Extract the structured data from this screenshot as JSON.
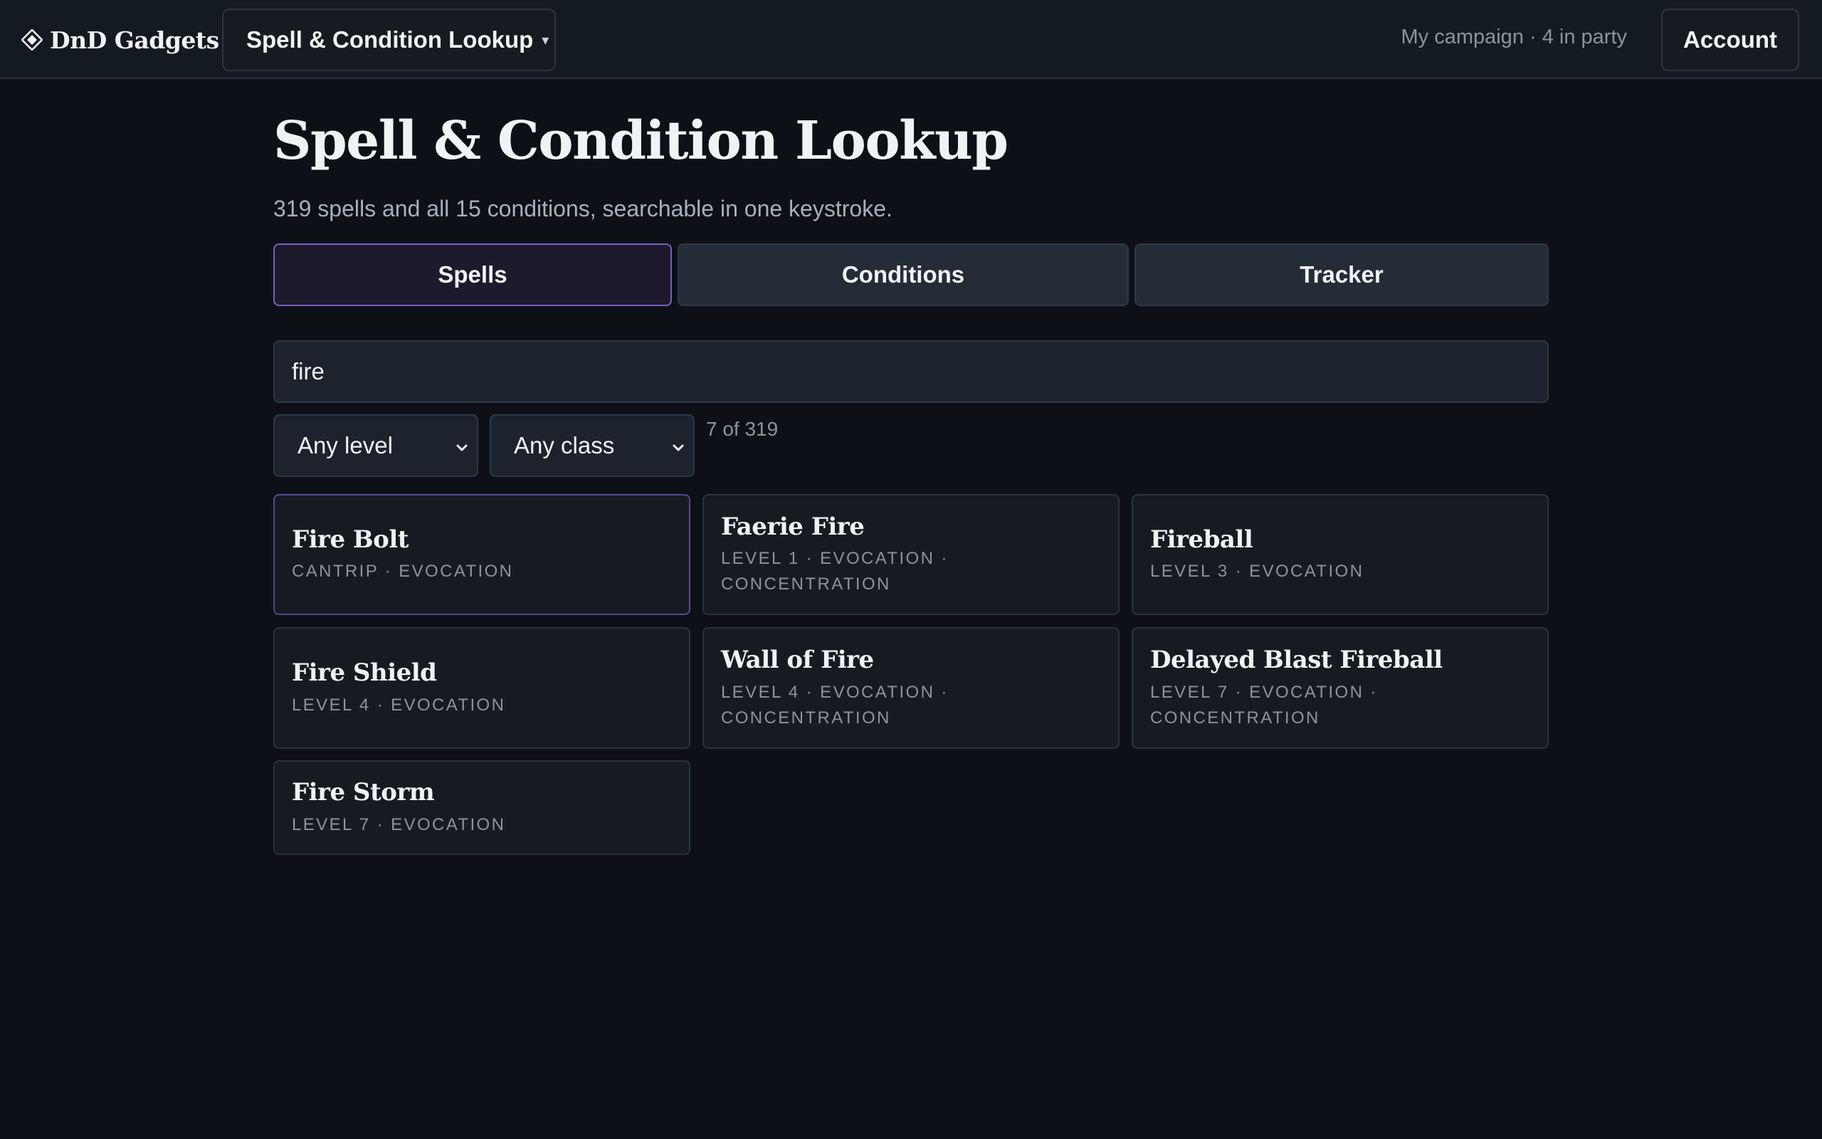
{
  "header": {
    "brand": "DnD Gadgets",
    "brand_icon": "diamond-icon",
    "tool_switcher_label": "Spell & Condition Lookup",
    "tool_switcher_caret": "▾",
    "campaign_status": "My campaign · 4 in party",
    "account_label": "Account"
  },
  "page": {
    "title": "Spell & Condition Lookup",
    "subtitle": "319 spells and all 15 conditions, searchable in one keystroke."
  },
  "tabs": [
    {
      "label": "Spells",
      "active": true
    },
    {
      "label": "Conditions",
      "active": false
    },
    {
      "label": "Tracker",
      "active": false
    }
  ],
  "search": {
    "value": "fire",
    "placeholder": ""
  },
  "filters": {
    "level": "Any level",
    "class": "Any class",
    "result_count": "7 of 319"
  },
  "spells": [
    {
      "name": "Fire Bolt",
      "meta": "CANTRIP · EVOCATION"
    },
    {
      "name": "Faerie Fire",
      "meta": "LEVEL 1 · EVOCATION · CONCENTRATION"
    },
    {
      "name": "Fireball",
      "meta": "LEVEL 3 · EVOCATION"
    },
    {
      "name": "Fire Shield",
      "meta": "LEVEL 4 · EVOCATION"
    },
    {
      "name": "Wall of Fire",
      "meta": "LEVEL 4 · EVOCATION · CONCENTRATION"
    },
    {
      "name": "Delayed Blast Fireball",
      "meta": "LEVEL 7 · EVOCATION · CONCENTRATION"
    },
    {
      "name": "Fire Storm",
      "meta": "LEVEL 7 · EVOCATION"
    }
  ],
  "colors": {
    "background": "#0d1117",
    "accent": "#7c5cc4"
  }
}
